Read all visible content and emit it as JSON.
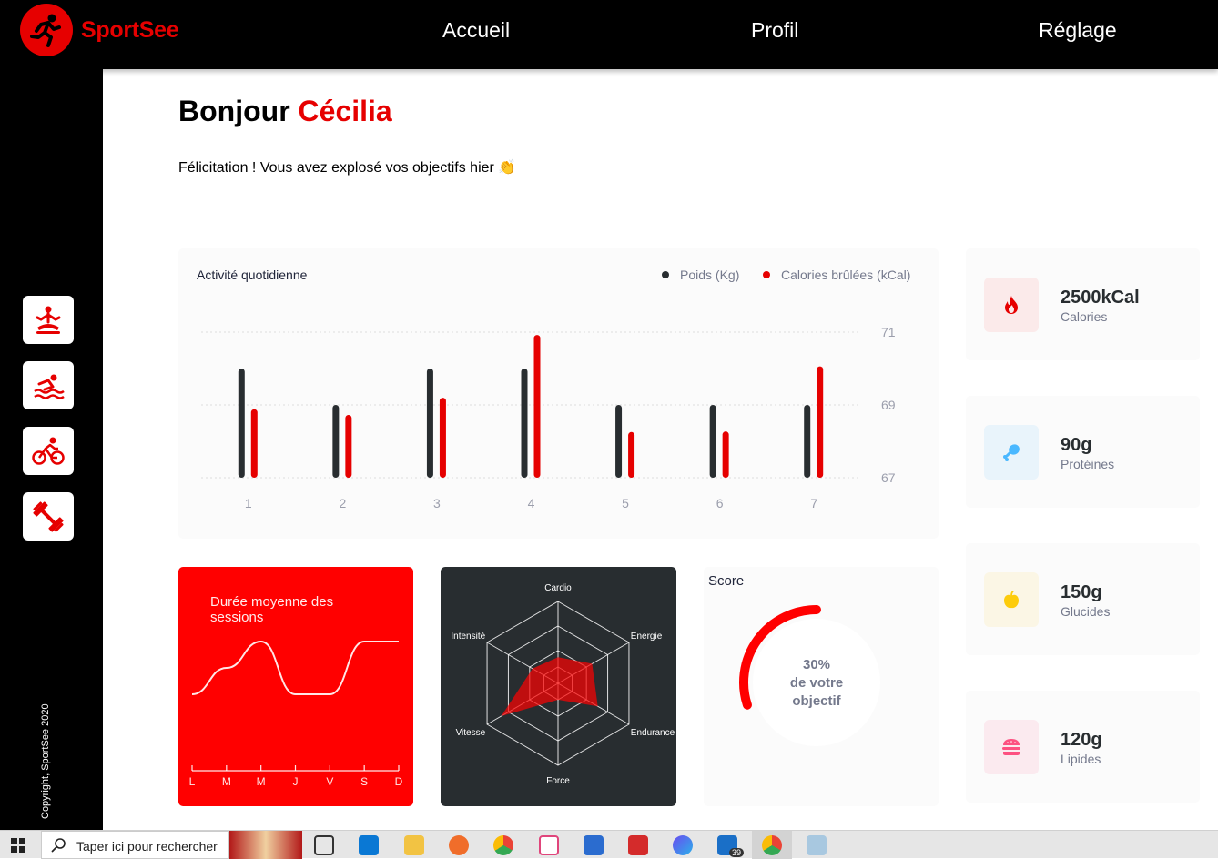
{
  "brand": {
    "name": "SportSee"
  },
  "nav": [
    "Accueil",
    "Profil",
    "Réglage"
  ],
  "sidebar": {
    "icons": [
      "meditation-icon",
      "swimming-icon",
      "cycling-icon",
      "dumbbell-icon"
    ],
    "copyright": "Copyright, SportSee 2020"
  },
  "greeting": {
    "hello": "Bonjour ",
    "name": "Cécilia"
  },
  "subtitle": "Félicitation ! Vous avez explosé vos objectifs hier 👏",
  "activity": {
    "title": "Activité quotidienne",
    "legend": {
      "weight": "Poids (Kg)",
      "calories": "Calories brûlées (kCal)"
    },
    "colors": {
      "weight": "#282d30",
      "calories": "#e60000"
    }
  },
  "sessions": {
    "title": "Durée moyenne des sessions"
  },
  "performance": {},
  "score": {
    "title": "Score",
    "percent": "30%",
    "line1": "de votre",
    "line2": "objectif",
    "value": 0.3
  },
  "kpis": [
    {
      "value": "2500kCal",
      "label": "Calories",
      "icon": "fire-icon",
      "bg": "#fbeaea",
      "color": "#e60000"
    },
    {
      "value": "90g",
      "label": "Protéines",
      "icon": "chicken-icon",
      "bg": "#e9f4fb",
      "color": "#4ab8ff"
    },
    {
      "value": "150g",
      "label": "Glucides",
      "icon": "apple-icon",
      "bg": "#fbf6e5",
      "color": "#fdcc0c"
    },
    {
      "value": "120g",
      "label": "Lipides",
      "icon": "cheeseburger-icon",
      "bg": "#fbeaef",
      "color": "#fd5181"
    }
  ],
  "taskbar": {
    "search_placeholder": "Taper ici pour rechercher",
    "mail_badge": "39"
  },
  "chart_data": [
    {
      "type": "bar",
      "title": "Activité quotidienne",
      "categories": [
        "1",
        "2",
        "3",
        "4",
        "5",
        "6",
        "7"
      ],
      "series": [
        {
          "name": "Poids (Kg)",
          "values": [
            70,
            69,
            70,
            70,
            69,
            69,
            69
          ]
        },
        {
          "name": "Calories brûlées (kCal)",
          "values": [
            240,
            220,
            280,
            500,
            160,
            162,
            390
          ]
        }
      ],
      "y_ticks": [
        67,
        69,
        71
      ],
      "ylim": [
        67,
        71
      ],
      "grid": true,
      "legend": "top-right"
    },
    {
      "type": "line",
      "title": "Durée moyenne des sessions",
      "categories": [
        "L",
        "M",
        "M",
        "J",
        "V",
        "S",
        "D"
      ],
      "values": [
        30,
        40,
        50,
        30,
        30,
        50,
        50
      ]
    },
    {
      "type": "radar",
      "categories": [
        "Cardio",
        "Energie",
        "Endurance",
        "Force",
        "Vitesse",
        "Intensité"
      ],
      "values": [
        80,
        120,
        140,
        50,
        200,
        90
      ],
      "max": 250
    },
    {
      "type": "pie",
      "title": "Score",
      "values": [
        30
      ],
      "unit": "%"
    }
  ]
}
